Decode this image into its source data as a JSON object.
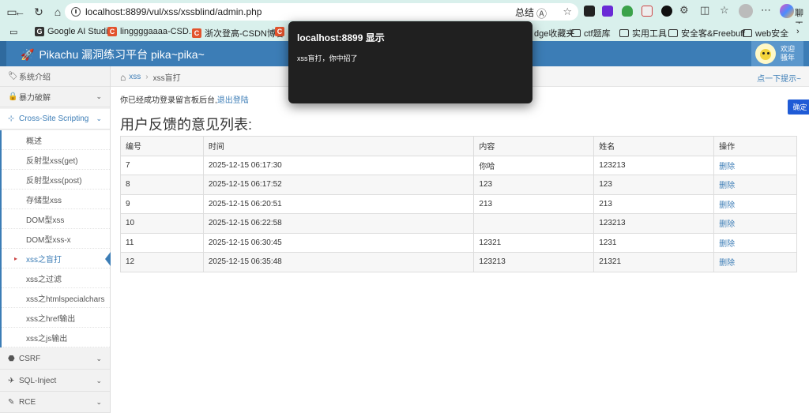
{
  "browser": {
    "url": "localhost:8899/vul/xss/xssblind/admin.php",
    "summarize_label": "总结",
    "copilot_label": "聊天"
  },
  "bookmarks": [
    {
      "label": "Google AI Studio",
      "icon": "google-ai-studio-icon"
    },
    {
      "label": "linggggaaaa-CSD...",
      "icon": "csdn-icon"
    },
    {
      "label": "浙次登高-CSDN博客",
      "icon": "csdn-icon"
    },
    {
      "label": "dge收藏夹",
      "icon": "folder-icon"
    },
    {
      "label": "ctf题库",
      "icon": "folder-icon"
    },
    {
      "label": "实用工具",
      "icon": "folder-icon"
    },
    {
      "label": "安全客&Freebuff",
      "icon": "folder-icon"
    },
    {
      "label": "web安全",
      "icon": "folder-icon"
    }
  ],
  "app": {
    "title": "Pikachu 漏洞练习平台 pika~pika~",
    "welcome_line1": "欢迎",
    "welcome_line2": "骚年"
  },
  "sidebar": {
    "items": [
      {
        "label": "系统介绍",
        "icon": "tags-icon"
      },
      {
        "label": "暴力破解",
        "icon": "lock-icon"
      },
      {
        "label": "Cross-Site Scripting",
        "icon": "sitemap-icon"
      },
      {
        "label": "CSRF",
        "icon": "csrf-icon"
      },
      {
        "label": "SQL-Inject",
        "icon": "plane-icon"
      },
      {
        "label": "RCE",
        "icon": "pencil-icon"
      }
    ],
    "xss_sub": [
      "概述",
      "反射型xss(get)",
      "反射型xss(post)",
      "存储型xss",
      "DOM型xss",
      "DOM型xss-x",
      "xss之盲打",
      "xss之过滤",
      "xss之htmlspecialchars",
      "xss之href输出",
      "xss之js输出"
    ]
  },
  "breadcrumb": {
    "link": "xss",
    "current": "xss盲打",
    "hint": "点一下提示~"
  },
  "main": {
    "login_msg": "你已经成功登录留言板后台,",
    "logout_link": "退出登陆",
    "heading": "用户反馈的意见列表:",
    "columns": [
      "编号",
      "时间",
      "内容",
      "姓名",
      "操作"
    ],
    "rows": [
      [
        "7",
        "2025-12-15 06:17:30",
        "你哈",
        "123213",
        "删除"
      ],
      [
        "8",
        "2025-12-15 06:17:52",
        "123",
        "123",
        "删除"
      ],
      [
        "9",
        "2025-12-15 06:20:51",
        "213",
        "213",
        "删除"
      ],
      [
        "10",
        "2025-12-15 06:22:58",
        "",
        "123213",
        "删除"
      ],
      [
        "11",
        "2025-12-15 06:30:45",
        "12321",
        "1231",
        "删除"
      ],
      [
        "12",
        "2025-12-15 06:35:48",
        "123213",
        "21321",
        "删除"
      ]
    ]
  },
  "dialog": {
    "title": "localhost:8899 显示",
    "message": "xss盲打，你中招了",
    "ok_label": "确定"
  },
  "colors": {
    "header_blue": "#3c7db6",
    "dialog_bg": "#202020",
    "ok_button": "#1f5bd6",
    "browser_chrome": "#d9f0ec"
  }
}
